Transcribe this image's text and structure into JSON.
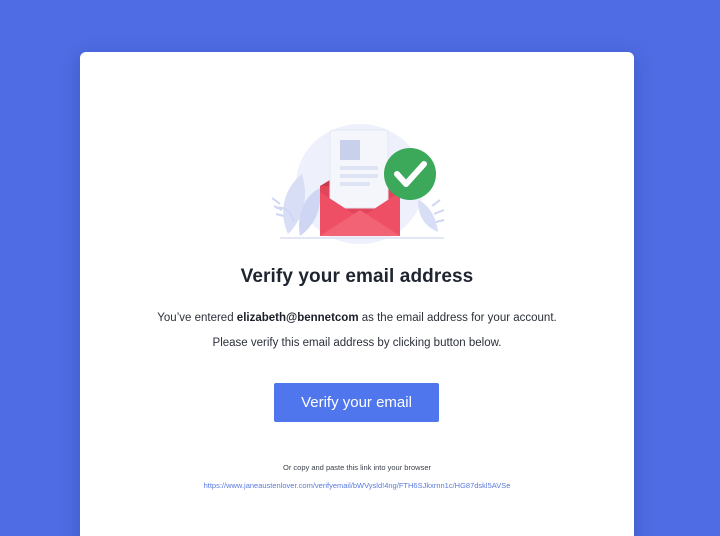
{
  "email_card": {
    "title": "Verify your email address",
    "message_prefix": "You’ve entered ",
    "email": "elizabeth@bennetcom",
    "message_suffix": " as the email address for your account.",
    "instruction": "Please verify this email address by clicking button below.",
    "verify_button_label": "Verify your email",
    "copy_hint": "Or copy and paste this link into your browser",
    "verify_link": "https://www.janeaustenlover.com/verifyemail/bWVysld!4ng/FTH6SJkxrnn1c/HG87dskl5AVSe"
  },
  "illustration": {
    "icons": [
      "envelope-icon",
      "document-icon",
      "checkmark-badge-icon",
      "leaf-decoration-icon"
    ]
  },
  "colors": {
    "background": "#4f6ce4",
    "card": "#ffffff",
    "button": "#4f76ec",
    "link": "#5a7ae0",
    "envelope": "#ef4f64",
    "check_badge": "#3ca85a"
  }
}
